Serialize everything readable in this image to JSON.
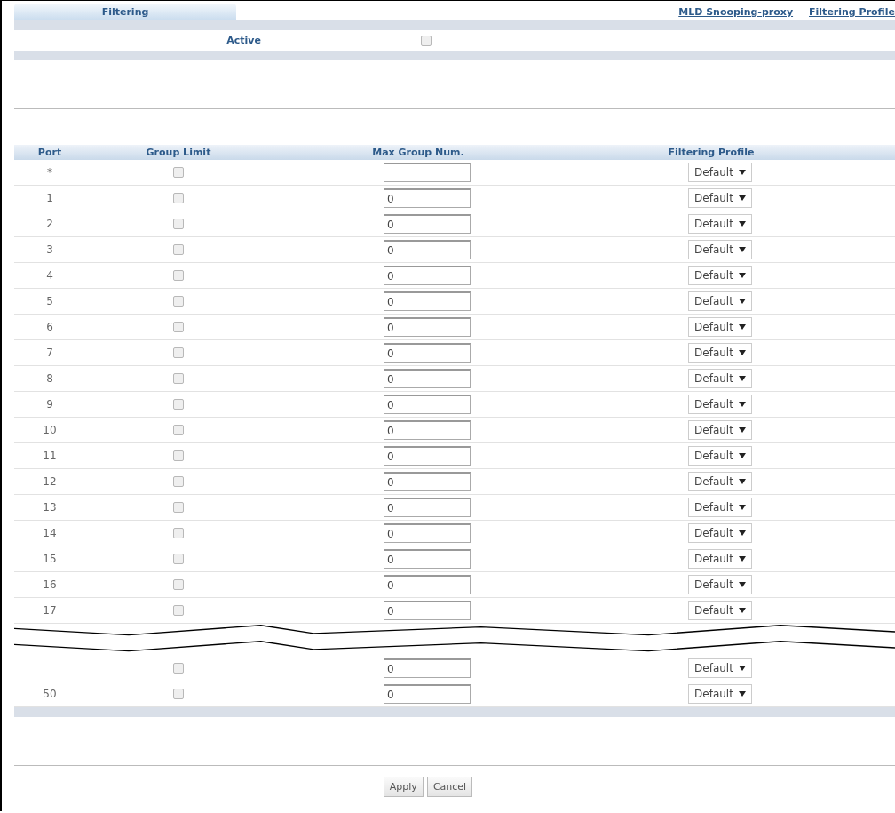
{
  "tab": {
    "label": "Filtering",
    "selected": true
  },
  "links": [
    "MLD Snooping-proxy",
    "Filtering Profile"
  ],
  "active": {
    "label": "Active",
    "checked": false
  },
  "table": {
    "columns": [
      "Port",
      "Group Limit",
      "Max Group Num.",
      "Filtering Profile"
    ],
    "rows": [
      {
        "kind": "port",
        "port": "*",
        "group_limit": false,
        "profile": "Default"
      },
      {
        "kind": "port",
        "port": "1",
        "group_limit": false,
        "max_group_num": "0",
        "profile": "Default"
      },
      {
        "kind": "port",
        "port": "2",
        "group_limit": false,
        "max_group_num": "0",
        "profile": "Default"
      },
      {
        "kind": "port",
        "port": "3",
        "group_limit": false,
        "max_group_num": "0",
        "profile": "Default"
      },
      {
        "kind": "port",
        "port": "4",
        "group_limit": false,
        "max_group_num": "0",
        "profile": "Default"
      },
      {
        "kind": "port",
        "port": "5",
        "group_limit": false,
        "max_group_num": "0",
        "profile": "Default"
      },
      {
        "kind": "port",
        "port": "6",
        "group_limit": false,
        "max_group_num": "0",
        "profile": "Default"
      },
      {
        "kind": "port",
        "port": "7",
        "group_limit": false,
        "max_group_num": "0",
        "profile": "Default"
      },
      {
        "kind": "port",
        "port": "8",
        "group_limit": false,
        "max_group_num": "0",
        "profile": "Default"
      },
      {
        "kind": "port",
        "port": "9",
        "group_limit": false,
        "max_group_num": "0",
        "profile": "Default"
      },
      {
        "kind": "port",
        "port": "10",
        "group_limit": false,
        "max_group_num": "0",
        "profile": "Default"
      },
      {
        "kind": "port",
        "port": "11",
        "group_limit": false,
        "max_group_num": "0",
        "profile": "Default"
      },
      {
        "kind": "port",
        "port": "12",
        "group_limit": false,
        "max_group_num": "0",
        "profile": "Default"
      },
      {
        "kind": "port",
        "port": "13",
        "group_limit": false,
        "max_group_num": "0",
        "profile": "Default"
      },
      {
        "kind": "port",
        "port": "14",
        "group_limit": false,
        "max_group_num": "0",
        "profile": "Default"
      },
      {
        "kind": "port",
        "port": "15",
        "group_limit": false,
        "max_group_num": "0",
        "profile": "Default"
      },
      {
        "kind": "port",
        "port": "16",
        "group_limit": false,
        "max_group_num": "0",
        "profile": "Default"
      },
      {
        "kind": "port",
        "port": "17",
        "group_limit": false,
        "max_group_num": "0",
        "profile": "Default"
      },
      {
        "kind": "break"
      },
      {
        "kind": "port",
        "group_limit": false,
        "max_group_num": "0",
        "profile": "Default"
      },
      {
        "kind": "port",
        "port": "50",
        "group_limit": false,
        "max_group_num": "0",
        "profile": "Default"
      }
    ]
  },
  "buttons": [
    "Apply",
    "Cancel"
  ]
}
